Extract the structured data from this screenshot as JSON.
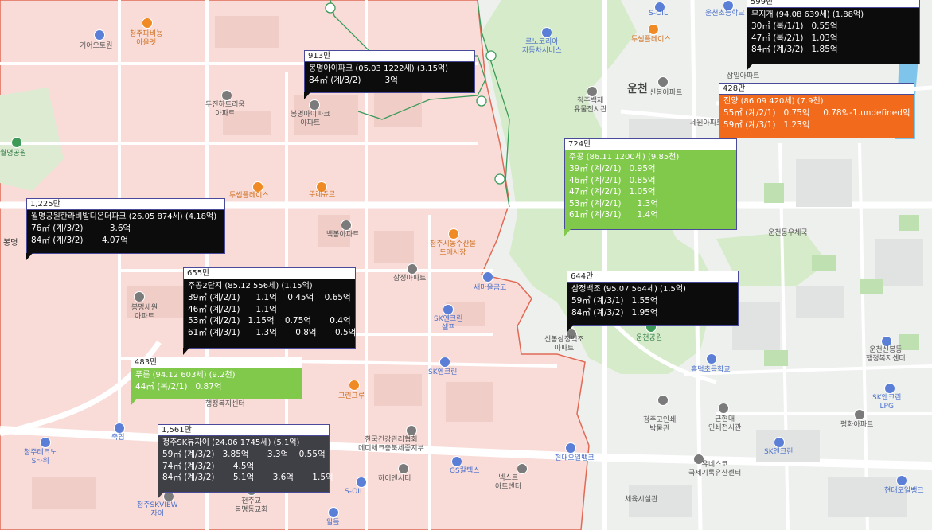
{
  "map_labels": {
    "gireotoreon": "기어오토뤈",
    "cheongju_park_vinyl": "청주파비뇽\n아울렛",
    "duzin": "두진하트리움\n아파트",
    "wolmyeong_park": "월명공원",
    "bongmyeong_ipark": "봉명아이파크\n아파트",
    "tuplace1": "투썸플레이스",
    "tujur": "뚜레쥬르",
    "baekbong": "백봉아파트",
    "bongmyeong": "봉명",
    "nongsu": "청주시농수산물\n도매시장",
    "samjeong": "삼정아파트",
    "saemaeul": "새마을금고",
    "sk_self": "SK엔크린\n셀프",
    "bongmyeong_sewon": "봉명세원\n아파트",
    "sk_encln": "SK엔크린",
    "greengru": "그린그루",
    "haengjeong": "행정복지센터",
    "cheongju_techno": "청주테크노\nS타워",
    "kuk": "축협",
    "korea_health": "한국건강관리협회\n메디체크충북세종지부",
    "highsan": "하이엔시티",
    "gscaltex": "GS칼텍스",
    "next_art": "넥스트\n아트센터",
    "s_oil_b": "S-OIL",
    "cheongju_skview": "청주SKVIEW\n자이",
    "cheonju_church": "천주교\n봉명동교회",
    "ulmil": "알틀",
    "s_oil_top": "S-OIL",
    "unchun_elem": "운천초등학교",
    "tuplace2": "투썸플레이스",
    "renocor": "르노코리아\n자동차서비스",
    "cheongju_baekje": "청주백제\n유물전시관",
    "uncheon": "운천",
    "sinbong_apt": "신봉아파트",
    "samil_apt": "삼일아파트",
    "sewon": "세원아파트",
    "uncheon_post": "운천동우체국",
    "sinbong_samjeong": "신봉삼정백조\n아파트",
    "uncheon_park": "운천공원",
    "heungdeok_elem": "흥덕초등학교",
    "uncheon_sinbong": "운천신봉동\n행정복지센터",
    "sk_lpg": "SK엔크린\nLPG",
    "pyeonghwa": "평화아파트",
    "cheongju_goin": "청주고인쇄\n박물관",
    "geunhyeondae": "근현대\n인쇄전시관",
    "sk_encln2": "SK엔크린",
    "hyundai_oil": "현대오일뱅크",
    "unesco": "유네스코\n국제기록유산센터",
    "hyundai_oil2": "현대오일뱅크",
    "chesuk": "체육시설관",
    "sinbong": "신봉"
  },
  "cards": {
    "top_right": {
      "price": "599만",
      "name": "무지개 (94.08 639세) (1.88억)",
      "rows": [
        "30㎡ (복/1/1)   0.55억",
        "47㎡ (복/2/1)   1.03억",
        "84㎡ (계/3/2)   1.85억"
      ]
    },
    "bongmyeong": {
      "price": "913만",
      "name": "봉명아이파크 (05.03 1222세) (3.15억)",
      "rows": [
        "84㎡ (계/3/2)         3억"
      ]
    },
    "jinyang": {
      "price": "428만",
      "name": "진양 (86.09 420세) (7.9천)",
      "rows": [
        "55㎡ (계/2/1)   0.75억     0.78억-1.undefined억",
        "59㎡ (계/3/1)   1.23억"
      ]
    },
    "jugong": {
      "price": "724만",
      "name": "주공 (86.11 1200세) (9.85천)",
      "rows": [
        "39㎡ (계/2/1)   0.95억",
        "46㎡ (계/2/1)   0.85억",
        "47㎡ (계/2/1)   1.05억",
        "53㎡ (계/2/1)      1.3억",
        "61㎡ (계/3/1)      1.4억"
      ]
    },
    "wolmyeong": {
      "price": "1,225만",
      "name": "월명공원한라비발디온더파크 (26.05 874세) (4.18억)",
      "rows": [
        "76㎡ (계/3/2)          3.6억",
        "84㎡ (계/3/2)       4.07억"
      ]
    },
    "jugong2": {
      "price": "655만",
      "name": "주공2단지 (85.12 556세) (1.15억)",
      "rows": [
        "39㎡ (계/2/1)      1.1억    0.45억    0.65억",
        "46㎡ (계/2/1)      1.1억",
        "53㎡ (계/2/1)   1.15억    0.75억       0.4억",
        "61㎡ (계/3/1)      1.3억       0.8억       0.5억"
      ]
    },
    "samjeong": {
      "price": "644만",
      "name": "삼정백조 (95.07 564세) (1.5억)",
      "rows": [
        "59㎡ (계/3/1)   1.55억",
        "84㎡ (계/3/2)   1.95억"
      ]
    },
    "pureun": {
      "price": "483만",
      "name": "푸른 (94.12 603세) (9.2천)",
      "rows": [
        "44㎡ (복/2/1)   0.87억"
      ]
    },
    "skview": {
      "price": "1,561만",
      "name": "청주SK뷰자이 (24.06 1745세) (5.1억)",
      "rows": [
        "59㎡ (계/3/2)   3.85억       3.3억    0.55억",
        "74㎡ (계/3/2)       4.5억",
        "84㎡ (계/3/2)       5.1억       3.6억       1.5억"
      ]
    }
  },
  "colors": {
    "residential_pink": "#f9dcd8",
    "district_border": "#e06a55",
    "park_green": "#cfe8c5",
    "road_white": "#ffffff",
    "river_blue": "#7fc4ea",
    "card_black": "#0c0c0c",
    "card_green": "#80c94a",
    "card_orange": "#f26a1b",
    "card_darkgray": "#3f3f46"
  }
}
